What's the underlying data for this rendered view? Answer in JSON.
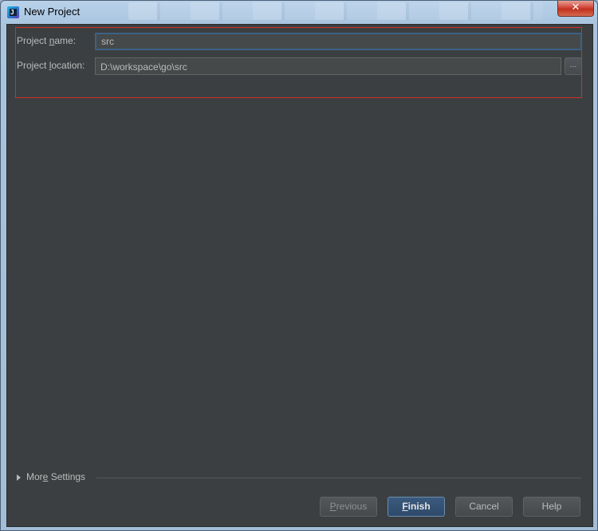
{
  "window": {
    "title": "New Project",
    "close_glyph": "✕"
  },
  "form": {
    "project_name": {
      "label_before": "Project ",
      "label_mnemonic": "n",
      "label_after": "ame:",
      "value": "src"
    },
    "project_location": {
      "label_before": "Project ",
      "label_mnemonic": "l",
      "label_after": "ocation:",
      "value": "D:\\workspace\\go\\src",
      "browse_label": "..."
    }
  },
  "more_settings": {
    "label_before": "Mor",
    "label_mnemonic": "e",
    "label_after": " Settings"
  },
  "buttons": {
    "previous": {
      "mnemonic": "P",
      "rest": "revious",
      "enabled": false
    },
    "finish": {
      "mnemonic": "F",
      "rest": "inish",
      "default": true
    },
    "cancel": {
      "label": "Cancel"
    },
    "help": {
      "label": "Help"
    }
  },
  "colors": {
    "dialog_background": "#3c3f41",
    "text": "#bbbbbb",
    "highlight_frame": "#d0302b",
    "focus_border": "#3d6185",
    "default_button": "#365880"
  },
  "icons": {
    "app": "intellij-app-icon",
    "close": "close-icon",
    "expand": "triangle-right-icon"
  }
}
